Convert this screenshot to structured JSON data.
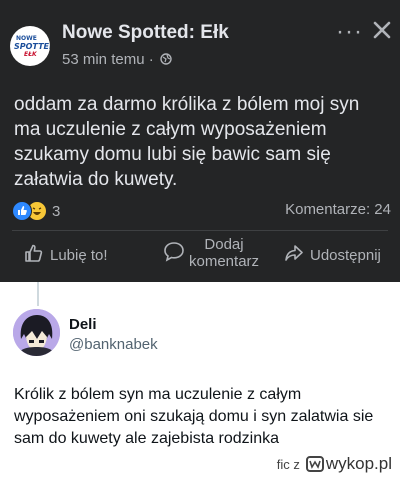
{
  "facebook": {
    "page_name": "Nowe Spotted: Ełk",
    "page_logo": {
      "top": "NOWE",
      "mid": "SPOTTED",
      "bottom": "EŁK"
    },
    "time": "53 min temu ·",
    "more_icon": "···",
    "post_text": "oddam za darmo królika z bólem moj syn ma uczulenie z całym wyposażeniem szukamy domu lubi się bawic sam się załatwia do kuwety.",
    "reaction_count": "3",
    "comments": "Komentarze: 24",
    "like_label": "Lubię to!",
    "comment_label_1": "Dodaj",
    "comment_label_2": "komentarz",
    "share_label": "Udostępnij",
    "colors": {
      "background": "#242526",
      "text": "#e4e6eb",
      "muted": "#b0b3b8",
      "like_blue": "#2e89ff"
    }
  },
  "tweet": {
    "author_name": "Deli",
    "author_handle": "@banknabek",
    "text": "Królik z bólem syn ma uczulenie z całym wyposażeniem oni szukają domu i syn zalatwia sie sam do kuwety ale zajebista rodzinka"
  },
  "watermark": {
    "prefix": "fic z",
    "site": "wykop.pl"
  }
}
